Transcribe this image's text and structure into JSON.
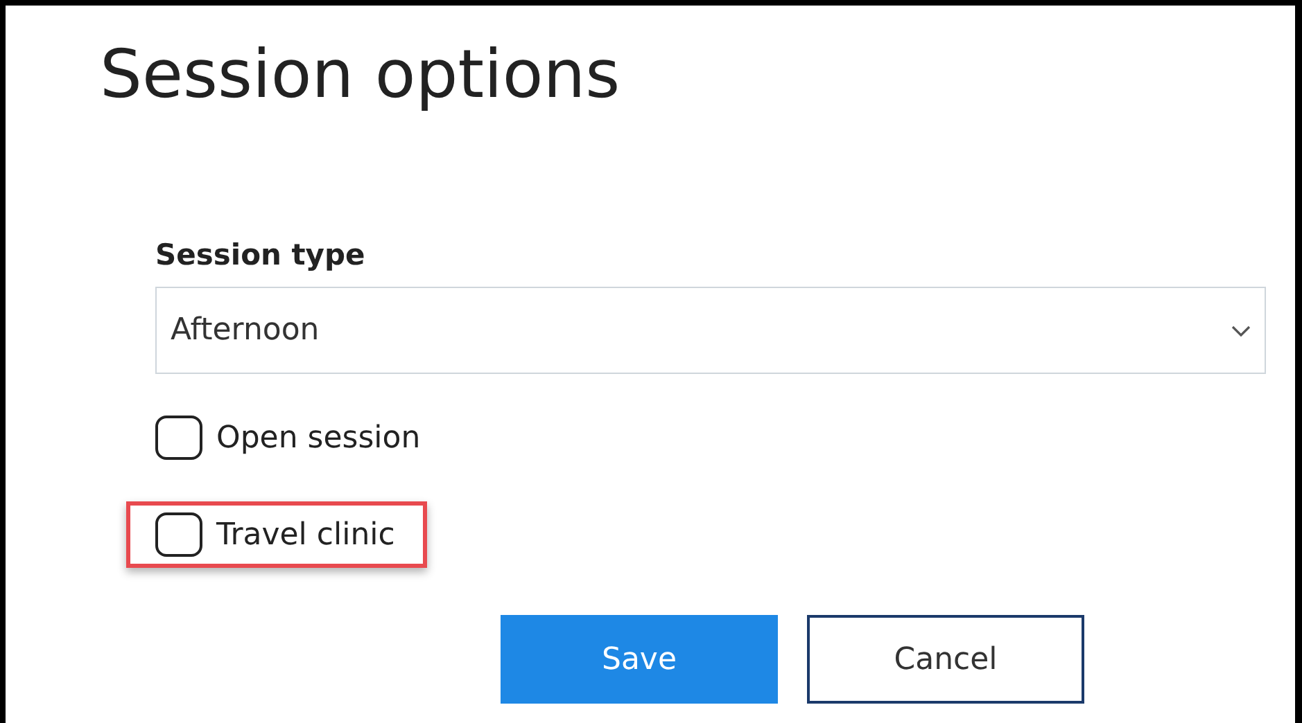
{
  "title": "Session options",
  "session_type": {
    "label": "Session type",
    "value": "Afternoon"
  },
  "options": [
    {
      "label": "Open session",
      "checked": false,
      "highlighted": false
    },
    {
      "label": "Travel clinic",
      "checked": false,
      "highlighted": true
    }
  ],
  "buttons": [
    {
      "label": "Save",
      "kind": "primary"
    },
    {
      "label": "Cancel",
      "kind": "secondary"
    }
  ]
}
